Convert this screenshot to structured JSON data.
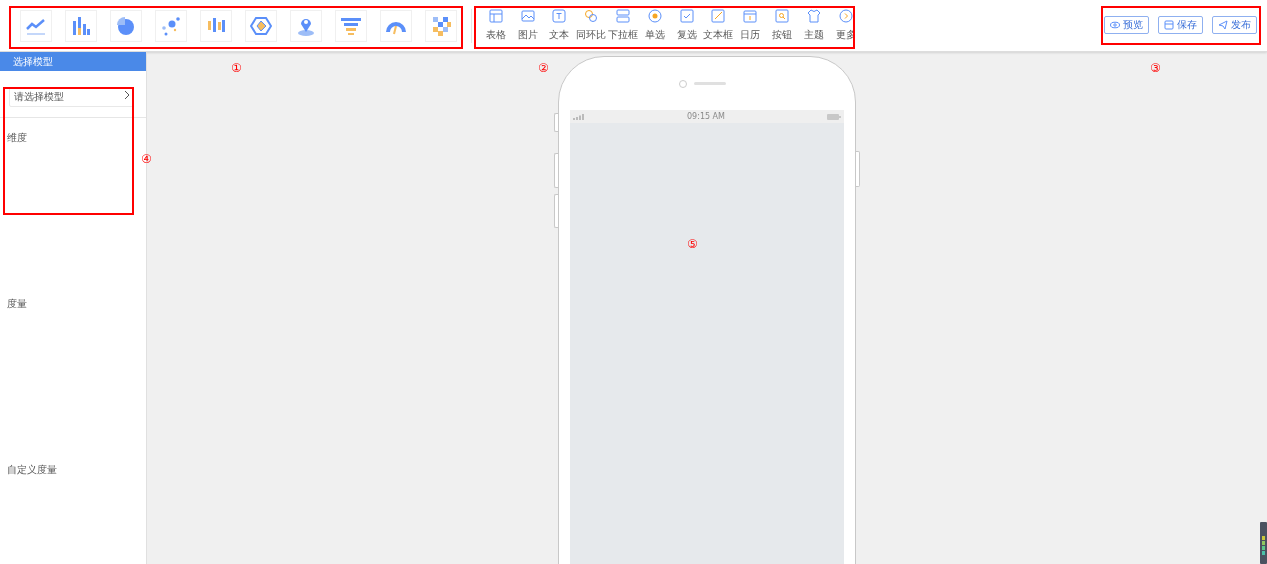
{
  "chart_types": [
    {
      "kind": "line"
    },
    {
      "kind": "bar"
    },
    {
      "kind": "pie"
    },
    {
      "kind": "scatter"
    },
    {
      "kind": "candlestick"
    },
    {
      "kind": "radar"
    },
    {
      "kind": "map"
    },
    {
      "kind": "funnel"
    },
    {
      "kind": "gauge"
    },
    {
      "kind": "heatmap"
    }
  ],
  "components": [
    {
      "label": "表格",
      "kind": "table"
    },
    {
      "label": "图片",
      "kind": "image"
    },
    {
      "label": "文本",
      "kind": "text"
    },
    {
      "label": "同环比",
      "kind": "compare"
    },
    {
      "label": "下拉框",
      "kind": "dropdown"
    },
    {
      "label": "单选",
      "kind": "radio"
    },
    {
      "label": "复选",
      "kind": "checkbox"
    },
    {
      "label": "文本框",
      "kind": "textbox"
    },
    {
      "label": "日历",
      "kind": "calendar"
    },
    {
      "label": "按钮",
      "kind": "button"
    },
    {
      "label": "主题",
      "kind": "theme"
    },
    {
      "label": "更多",
      "kind": "more"
    }
  ],
  "actions": [
    {
      "label": "预览",
      "kind": "preview"
    },
    {
      "label": "保存",
      "kind": "save"
    },
    {
      "label": "发布",
      "kind": "publish"
    }
  ],
  "sidebar": {
    "header": "选择模型",
    "model_select": {
      "placeholder": "请选择模型"
    },
    "sections": [
      {
        "label": "维度"
      },
      {
        "label": "度量"
      },
      {
        "label": "自定义度量"
      }
    ]
  },
  "phone": {
    "time": "09:15 AM"
  },
  "annotations": [
    {
      "label": "①"
    },
    {
      "label": "②"
    },
    {
      "label": "③"
    },
    {
      "label": "④"
    },
    {
      "label": "⑤"
    }
  ]
}
